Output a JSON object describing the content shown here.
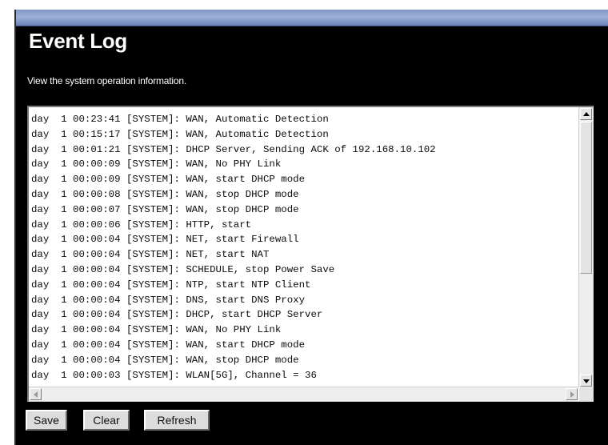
{
  "page": {
    "title": "Event Log",
    "description": "View the system operation information."
  },
  "log": {
    "lines": [
      "day  1 00:23:41 [SYSTEM]: WAN, Automatic Detection",
      "day  1 00:15:17 [SYSTEM]: WAN, Automatic Detection",
      "day  1 00:01:21 [SYSTEM]: DHCP Server, Sending ACK of 192.168.10.102",
      "day  1 00:00:09 [SYSTEM]: WAN, No PHY Link",
      "day  1 00:00:09 [SYSTEM]: WAN, start DHCP mode",
      "day  1 00:00:08 [SYSTEM]: WAN, stop DHCP mode",
      "day  1 00:00:07 [SYSTEM]: WAN, stop DHCP mode",
      "day  1 00:00:06 [SYSTEM]: HTTP, start",
      "day  1 00:00:04 [SYSTEM]: NET, start Firewall",
      "day  1 00:00:04 [SYSTEM]: NET, start NAT",
      "day  1 00:00:04 [SYSTEM]: SCHEDULE, stop Power Save",
      "day  1 00:00:04 [SYSTEM]: NTP, start NTP Client",
      "day  1 00:00:04 [SYSTEM]: DNS, start DNS Proxy",
      "day  1 00:00:04 [SYSTEM]: DHCP, start DHCP Server",
      "day  1 00:00:04 [SYSTEM]: WAN, No PHY Link",
      "day  1 00:00:04 [SYSTEM]: WAN, start DHCP mode",
      "day  1 00:00:04 [SYSTEM]: WAN, stop DHCP mode",
      "day  1 00:00:03 [SYSTEM]: WLAN[5G], Channel = 36"
    ]
  },
  "buttons": {
    "save": "Save",
    "clear": "Clear",
    "refresh": "Refresh"
  },
  "colors": {
    "background": "#000000",
    "title_bar": "#8ea3cf",
    "text": "#ffffff",
    "log_text": "#0b0b0b"
  }
}
